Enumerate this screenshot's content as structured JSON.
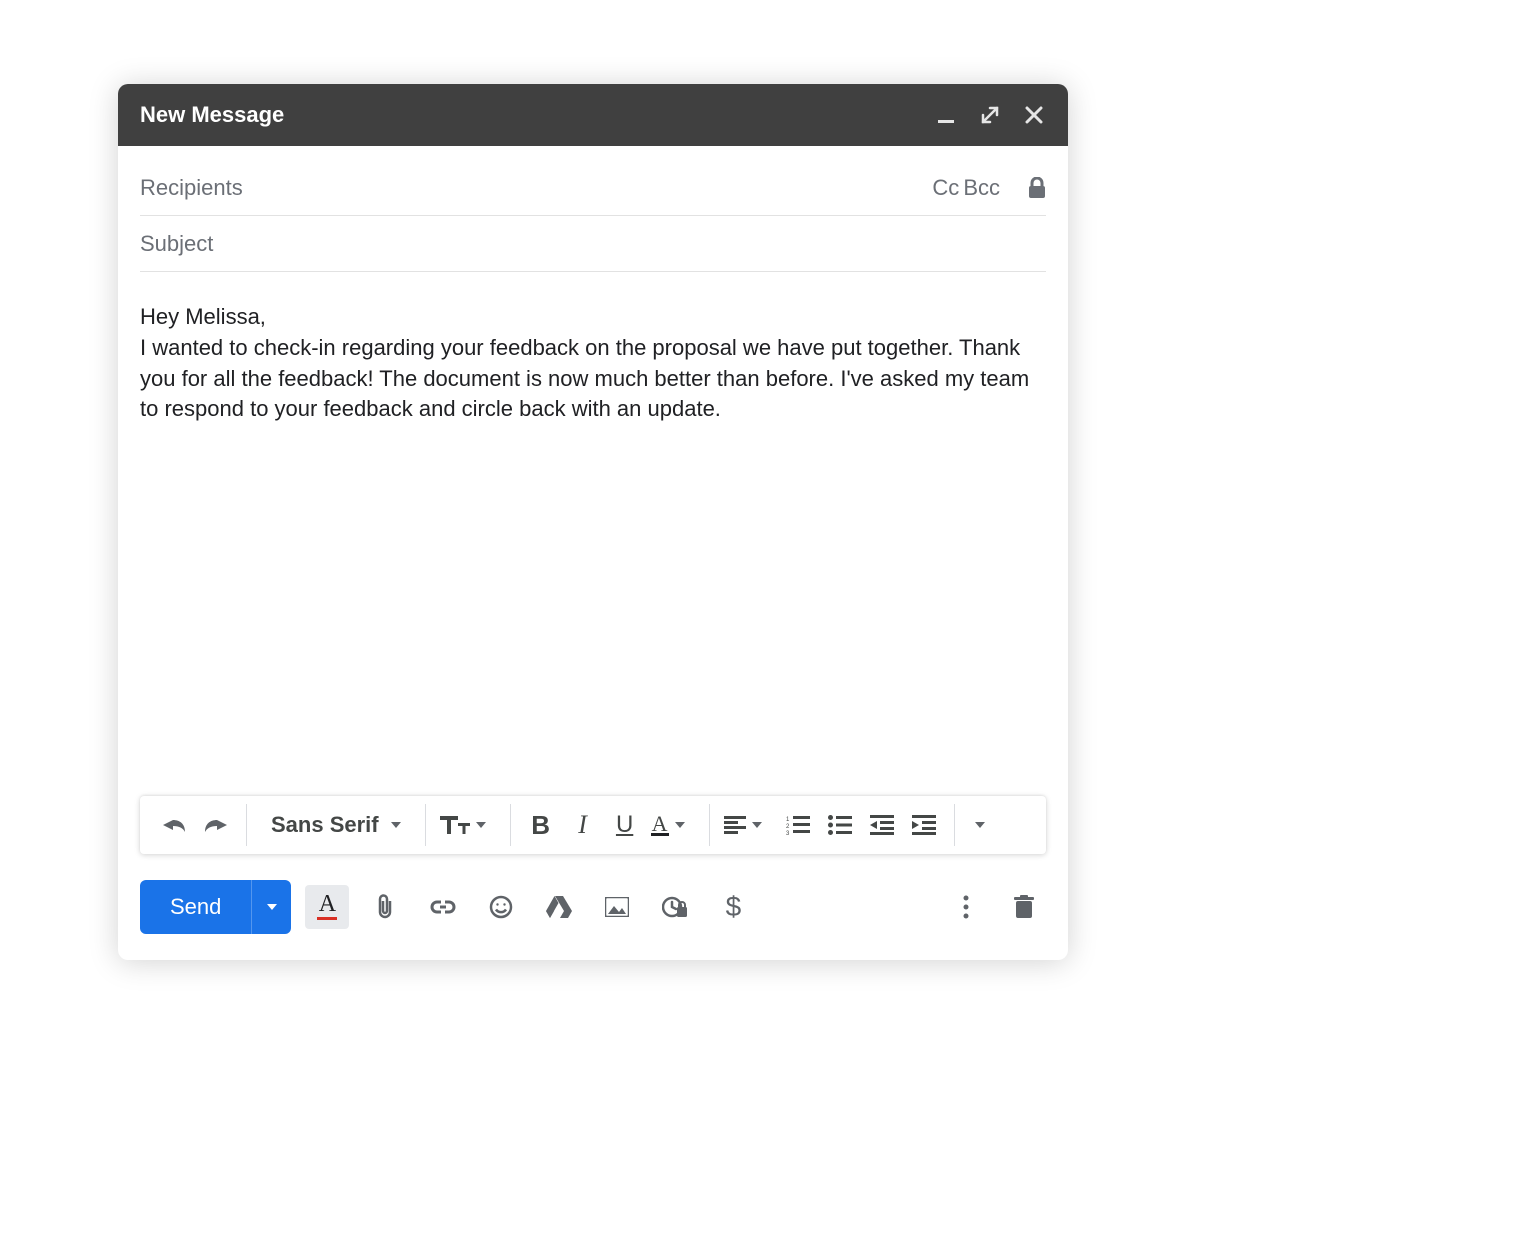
{
  "window": {
    "title": "New Message"
  },
  "fields": {
    "recipients_placeholder": "Recipients",
    "cc_label": "Cc",
    "bcc_label": "Bcc",
    "subject_placeholder": "Subject"
  },
  "body": {
    "line1": "Hey Melissa,",
    "line2": "I wanted to check-in regarding your feedback on the proposal we have put together. Thank you for all the feedback! The document is now much better than before. I've asked my team to respond to your feedback and circle back with an update."
  },
  "format_toolbar": {
    "font_name": "Sans Serif",
    "bold": "B",
    "italic": "I",
    "underline": "U",
    "text_color_glyph": "A"
  },
  "actions": {
    "send_label": "Send",
    "text_color_glyph": "A",
    "dollar_glyph": "$"
  }
}
